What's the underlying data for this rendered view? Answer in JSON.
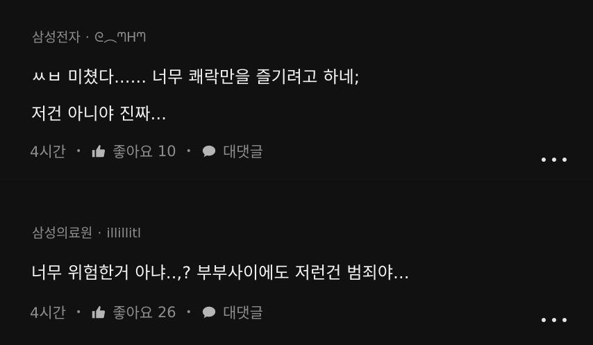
{
  "colors": {
    "background": "#111111",
    "body_text": "#f4f4f4",
    "meta_text": "#8e8e8e",
    "more_dots": "#e6e6e6"
  },
  "comments": [
    {
      "company": "삼성전자",
      "separator": "·",
      "nickname": "ᘓ︵ᘉᕼᘉ",
      "lines": [
        "ㅆㅂ 미쳤다...... 너무 쾌락만을 즐기려고 하네;",
        "저건 아니야 진짜..."
      ],
      "time": "4시간",
      "like_label": "좋아요",
      "like_count": "10",
      "reply_label": "대댓글",
      "like_icon": "thumbs-up-icon",
      "reply_icon": "speech-bubble-icon",
      "more_icon": "more-dots-icon"
    },
    {
      "company": "삼성의료원",
      "separator": "·",
      "nickname": "illillitl",
      "lines": [
        "너무 위험한거 아냐..,? 부부사이에도 저런건 범죄야..."
      ],
      "time": "4시간",
      "like_label": "좋아요",
      "like_count": "26",
      "reply_label": "대댓글",
      "like_icon": "thumbs-up-icon",
      "reply_icon": "speech-bubble-icon",
      "more_icon": "more-dots-icon"
    }
  ],
  "action_separator": "•"
}
